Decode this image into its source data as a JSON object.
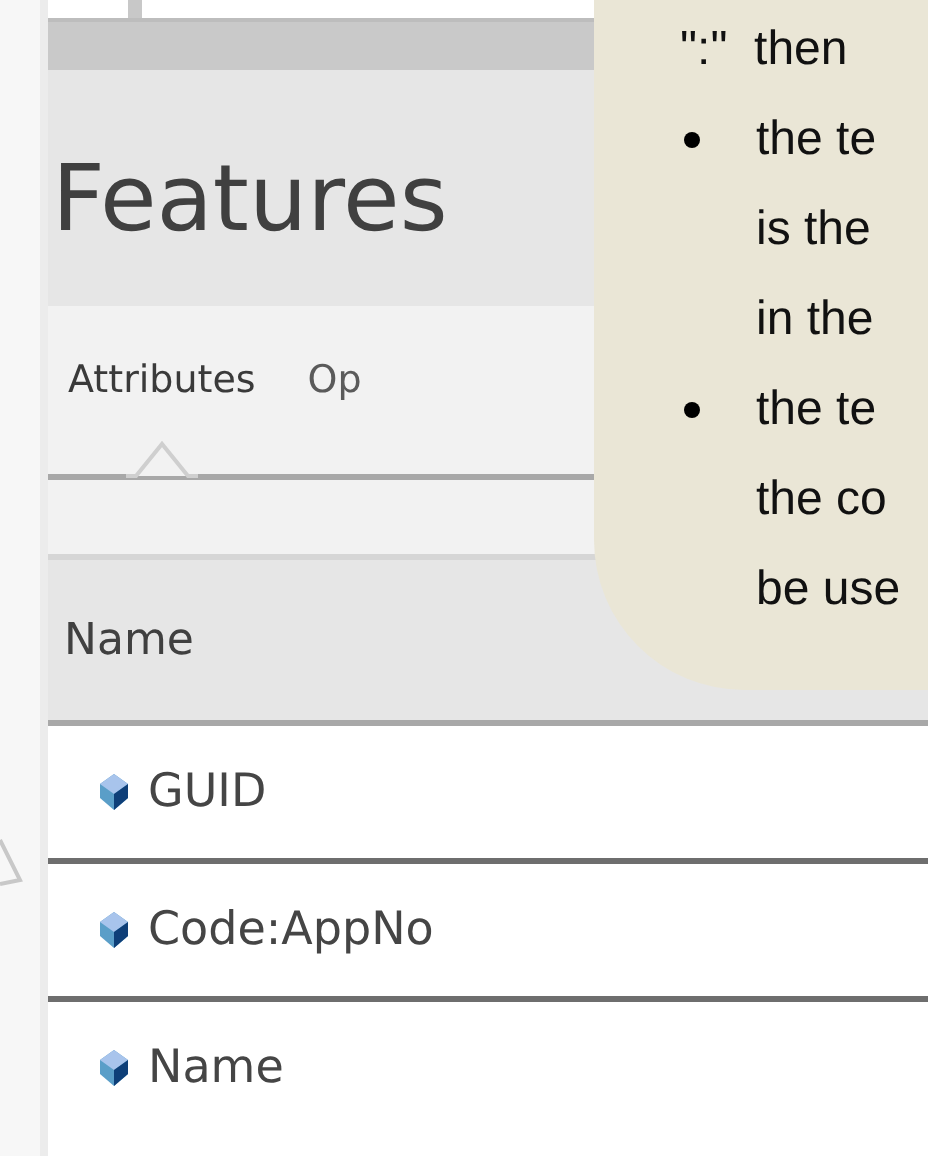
{
  "panel": {
    "title": "Features",
    "tabs": [
      {
        "label": "Attributes",
        "selected": true
      },
      {
        "label": "Op",
        "selected": false
      }
    ],
    "table": {
      "columns": [
        "Name"
      ],
      "rows": [
        {
          "name": "GUID"
        },
        {
          "name": "Code:AppNo"
        },
        {
          "name": "Name"
        }
      ]
    }
  },
  "callout": {
    "intro": "\":\"  then",
    "bullets": [
      {
        "lines": [
          "the te",
          "is the",
          "in the"
        ]
      },
      {
        "lines": [
          "the te",
          "the co",
          "be use"
        ]
      }
    ]
  }
}
